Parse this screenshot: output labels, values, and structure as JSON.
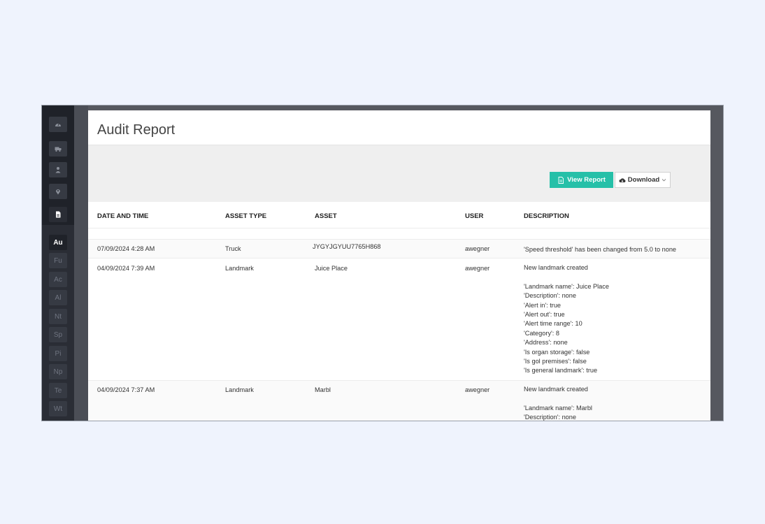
{
  "sidebar": {
    "nav_icons": [
      {
        "icon": "dashboard-icon"
      },
      {
        "icon": "truck-icon"
      },
      {
        "icon": "user-icon"
      },
      {
        "icon": "map-pin-icon"
      },
      {
        "icon": "report-icon"
      }
    ],
    "codes": [
      "Au",
      "Fu",
      "Ac",
      "Al",
      "Nt",
      "Sp",
      "Pi",
      "Np",
      "Te",
      "Wt"
    ]
  },
  "page": {
    "title": "Audit Report"
  },
  "toolbar": {
    "view_label": "View Report",
    "download_label": "Download"
  },
  "table": {
    "headers": [
      "DATE AND TIME",
      "ASSET TYPE",
      "ASSET",
      "USER",
      "DESCRIPTION"
    ],
    "rows": [
      {
        "date": "07/09/2024 4:28 AM",
        "asset_type": "Truck",
        "asset": "JYGYJGYUU7765H868",
        "user": "awegner",
        "description": [
          "'Speed threshold' has been changed from 5.0 to none"
        ]
      },
      {
        "date": "04/09/2024 7:39 AM",
        "asset_type": "Landmark",
        "asset": "Juice Place",
        "user": "awegner",
        "description": [
          "New landmark created",
          "",
          "'Landmark name': Juice Place",
          "'Description': none",
          "'Alert in': true",
          "'Alert out': true",
          "'Alert time range': 10",
          "'Category': 8",
          "'Address': none",
          "'Is organ storage': false",
          "'Is gol premises': false",
          "'Is general landmark': true"
        ]
      },
      {
        "date": "04/09/2024 7:37 AM",
        "asset_type": "Landmark",
        "asset": "Marbl",
        "user": "awegner",
        "description": [
          "New landmark created",
          "",
          "'Landmark name': Marbl",
          "'Description': none"
        ]
      }
    ]
  },
  "colors": {
    "accent": "#26c0a8",
    "sidebar": "#2a2d35",
    "frame": "#56585f"
  }
}
